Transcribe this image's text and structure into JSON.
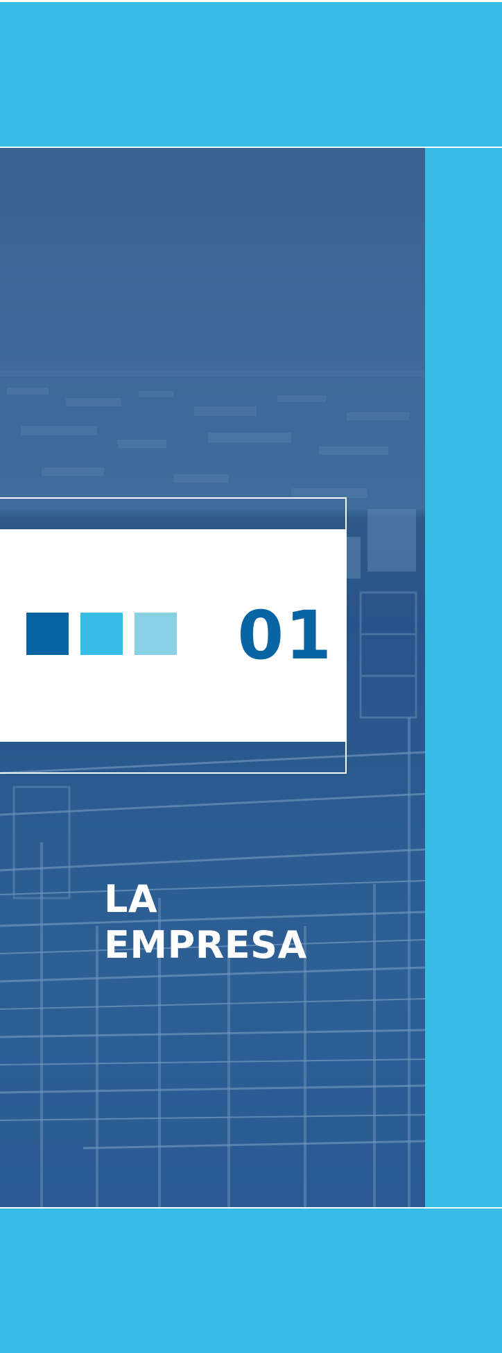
{
  "chapter": {
    "number": "01",
    "title_line_1": "LA",
    "title_line_2": "EMPRESA"
  },
  "palette": {
    "dark_blue": "#0864a2",
    "cyan": "#38bbe4",
    "light_blue": "#8ad0e4",
    "photo_overlay": "#2b5b90",
    "white": "#ffffff"
  }
}
